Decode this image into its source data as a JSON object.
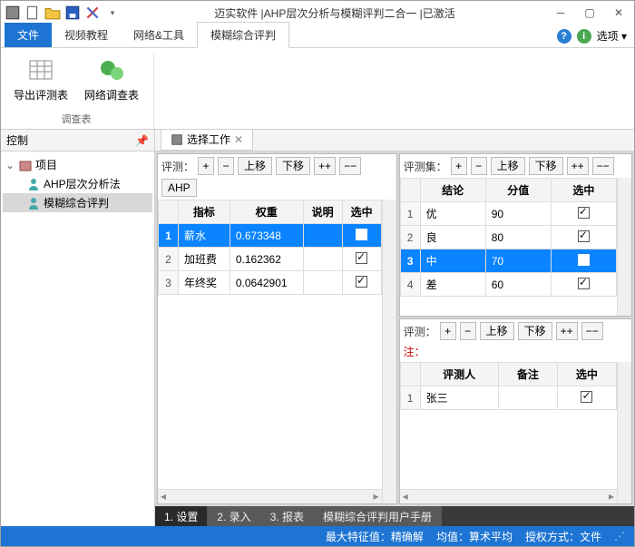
{
  "title": "迈实软件 |AHP层次分析与模糊评判二合一 |已激活",
  "ribbontabs": {
    "file": "文件",
    "video": "视频教程",
    "net": "网络&工具",
    "fuzzy": "模糊综合评判"
  },
  "ribbon": {
    "export": "导出评测表",
    "survey": "网络调查表",
    "group": "调查表"
  },
  "options": "选项",
  "ctrl": {
    "title": "控制",
    "project": "项目",
    "ahp": "AHP层次分析法",
    "fuzzy": "模糊综合评判"
  },
  "worktab": "选择工作",
  "toolbar": {
    "eval": "评测：",
    "evalset": "评测集：",
    "note": "注：",
    "plus": "+",
    "minus": "−",
    "up": "上移",
    "down": "下移",
    "pp": "++",
    "mm": "−−",
    "ahp": "AHP"
  },
  "grid1": {
    "headers": {
      "idx": "",
      "col1": "指标",
      "col2": "权重",
      "col3": "说明",
      "col4": "选中"
    },
    "rows": [
      {
        "n": "1",
        "c1": "薪水",
        "c2": "0.673348",
        "c3": "",
        "sel": true
      },
      {
        "n": "2",
        "c1": "加班费",
        "c2": "0.162362",
        "c3": "",
        "sel": false
      },
      {
        "n": "3",
        "c1": "年终奖",
        "c2": "0.0642901",
        "c3": "",
        "sel": false
      }
    ]
  },
  "grid2": {
    "headers": {
      "idx": "",
      "col1": "结论",
      "col2": "分值",
      "col3": "选中"
    },
    "rows": [
      {
        "n": "1",
        "c1": "优",
        "c2": "90",
        "sel": false
      },
      {
        "n": "2",
        "c1": "良",
        "c2": "80",
        "sel": false
      },
      {
        "n": "3",
        "c1": "中",
        "c2": "70",
        "sel": true
      },
      {
        "n": "4",
        "c1": "差",
        "c2": "60",
        "sel": false
      }
    ]
  },
  "grid3": {
    "headers": {
      "idx": "",
      "col1": "评测人",
      "col2": "备注",
      "col3": "选中"
    },
    "rows": [
      {
        "n": "1",
        "c1": "张三",
        "c2": "",
        "sel": false
      }
    ]
  },
  "bottomtabs": {
    "t1": "1. 设置",
    "t2": "2. 录入",
    "t3": "3. 报表",
    "t4": "模糊综合评判用户手册"
  },
  "status": {
    "eig": "最大特征值：",
    "acc": "精确解",
    "avg": "均值：",
    "avgm": "算术平均",
    "auth": "授权方式：",
    "authm": "文件"
  }
}
